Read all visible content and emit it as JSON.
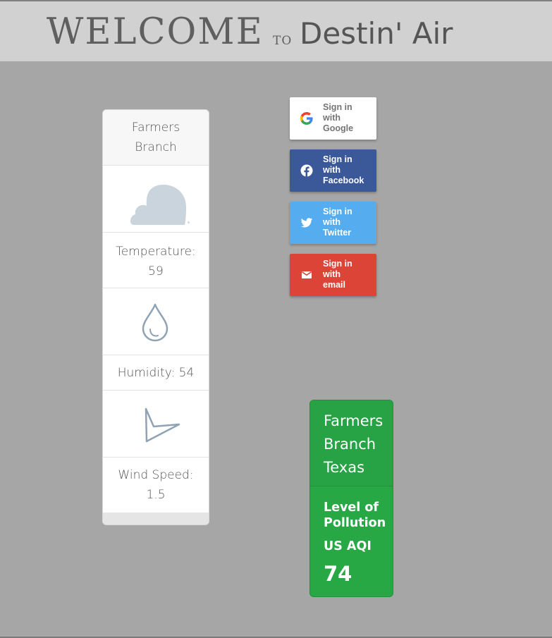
{
  "header": {
    "welcome": "WELCOME",
    "to": "TO",
    "brand": "Destin' Air"
  },
  "weather": {
    "city_line1": "Farmers",
    "city_line2": "Branch",
    "temperature_label": "Temperature:",
    "temperature_value": "59",
    "humidity_text": "Humidity: 54",
    "wind_label": "Wind Speed:",
    "wind_value": "1.5",
    "icons": [
      "cloud-icon",
      "droplet-icon",
      "wind-direction-icon"
    ]
  },
  "signin": {
    "google": [
      "Sign in",
      "with",
      "Google"
    ],
    "facebook": [
      "Sign in",
      "with",
      "Facebook"
    ],
    "twitter": [
      "Sign in",
      "with",
      "Twitter"
    ],
    "email": [
      "Sign in",
      "with",
      "email"
    ],
    "colors": {
      "google": "#ffffff",
      "facebook": "#3b5998",
      "twitter": "#55acee",
      "email": "#db4437"
    }
  },
  "aqi": {
    "location": [
      "Farmers",
      "Branch",
      "Texas"
    ],
    "heading_line1": "Level of",
    "heading_line2": "Pollution",
    "unit": "US AQI",
    "value": "74",
    "color": "#28a745"
  }
}
